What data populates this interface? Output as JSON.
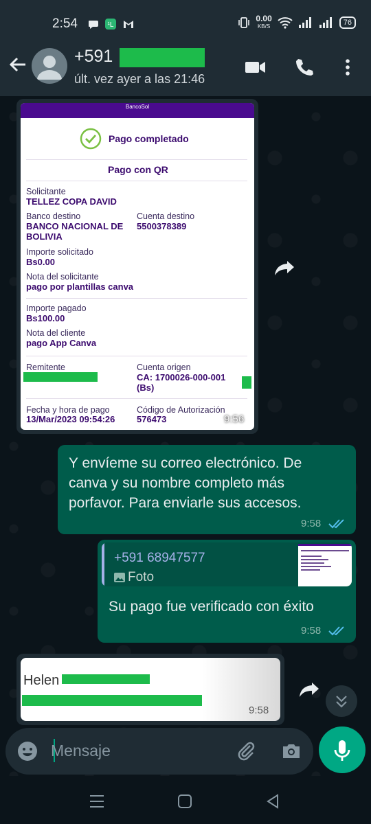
{
  "status_bar": {
    "time": "2:54",
    "net_speed_top": "0.00",
    "net_speed_unit": "KB/S",
    "battery": "76"
  },
  "header": {
    "contact_prefix": "+591",
    "last_seen": "últ. vez ayer a las 21:46",
    "icons": [
      "back-arrow-icon",
      "video-call-icon",
      "voice-call-icon",
      "more-options-icon"
    ]
  },
  "receipt": {
    "bank_logo_text": "BancoSol",
    "status": "Pago completado",
    "subtitle": "Pago con QR",
    "solicitante_label": "Solicitante",
    "solicitante_value": "TELLEZ COPA DAVID",
    "banco_destino_label": "Banco destino",
    "banco_destino_value_1": "BANCO NACIONAL DE",
    "banco_destino_value_2": "BOLIVIA",
    "cuenta_destino_label": "Cuenta destino",
    "cuenta_destino_value": "5500378389",
    "importe_solicitado_label": "Importe solicitado",
    "importe_solicitado_value": "Bs0.00",
    "nota_solicitante_label": "Nota del solicitante",
    "nota_solicitante_value": "pago por plantillas canva",
    "importe_pagado_label": "Importe pagado",
    "importe_pagado_value": "Bs100.00",
    "nota_cliente_label": "Nota del cliente",
    "nota_cliente_value": "pago App Canva",
    "remitente_label": "Remitente",
    "cuenta_origen_label": "Cuenta origen",
    "cuenta_origen_value_1": "CA: 1700026-000-001",
    "cuenta_origen_value_2": "(Bs)",
    "fecha_label": "Fecha y hora de pago",
    "fecha_value": "13/Mar/2023 09:54:26",
    "codigo_label": "Código de Autorización",
    "codigo_value": "576473",
    "time": "9:56"
  },
  "messages": [
    {
      "direction": "out",
      "text_1": "Y envíeme su correo electrónico. De",
      "text_2": "canva y su nombre completo más",
      "text_3": "porfavor. Para enviarle sus accesos.",
      "time": "9:58"
    },
    {
      "direction": "out",
      "quote_sender": "+591 68947577",
      "quote_type": "Foto",
      "text": "Su pago fue verificado con éxito",
      "time": "9:58"
    },
    {
      "direction": "in",
      "name_start": "Helen",
      "time": "9:58"
    }
  ],
  "input": {
    "placeholder": "Mensaje"
  },
  "colors": {
    "header_bg": "#1f2c34",
    "chat_bg": "#0b141a",
    "out_bubble": "#005c4b",
    "in_bubble": "#1f2c34",
    "accent": "#00a884",
    "read_ticks": "#53bdeb",
    "redaction": "#1dbb4b",
    "receipt_purple": "#3b0a6e"
  }
}
